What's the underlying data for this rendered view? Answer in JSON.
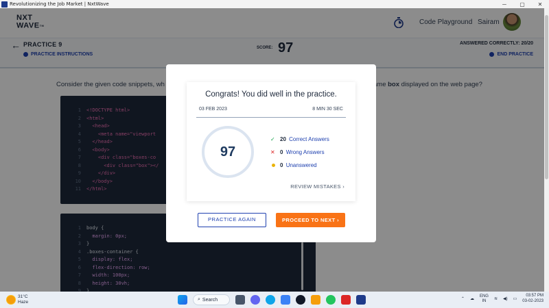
{
  "window": {
    "title": "Revolutionizing the Job Market | NxtWave",
    "minimize": "─",
    "maximize": "▢",
    "close": "✕"
  },
  "header": {
    "logo_line1": "NXT",
    "logo_line2": "WAVE",
    "logo_tm": "TM",
    "code_playground": "Code Playground",
    "username": "Sairam"
  },
  "practice_bar": {
    "title": "PRACTICE 9",
    "instructions": "PRACTICE INSTRUCTIONS",
    "score_label": "SCORE:",
    "score_value": "97",
    "answered": "ANSWERED CORRECTLY: 20/20",
    "end_practice": "END PRACTICE"
  },
  "question": {
    "left": "Consider the given code snippets, wh",
    "right_pre": "ame ",
    "right_bold": "box",
    "right_post": " displayed on the web page?"
  },
  "code_html": [
    {
      "n": "1",
      "t": "<!DOCTYPE html>"
    },
    {
      "n": "2",
      "t": "<html>"
    },
    {
      "n": "3",
      "t": "  <head>"
    },
    {
      "n": "4",
      "t": "    <meta name=\"viewport"
    },
    {
      "n": "5",
      "t": "  </head>"
    },
    {
      "n": "6",
      "t": "  <body>"
    },
    {
      "n": "7",
      "t": "    <div class=\"boxes-co"
    },
    {
      "n": "8",
      "t": "      <div class=\"box\"></"
    },
    {
      "n": "9",
      "t": "    </div>"
    },
    {
      "n": "10",
      "t": "  </body>"
    },
    {
      "n": "11",
      "t": "</html>"
    }
  ],
  "code_css": [
    {
      "n": "1",
      "t": "body {"
    },
    {
      "n": "2",
      "t": "  margin: 0px;"
    },
    {
      "n": "3",
      "t": "}"
    },
    {
      "n": "4",
      "t": ".boxes-container {"
    },
    {
      "n": "5",
      "t": "  display: flex;"
    },
    {
      "n": "6",
      "t": "  flex-direction: row;"
    },
    {
      "n": "7",
      "t": "  width: 100px;"
    },
    {
      "n": "8",
      "t": "  height: 30vh;"
    },
    {
      "n": "9",
      "t": "}"
    }
  ],
  "modal": {
    "congrats": "Congrats! You did well in the practice.",
    "date": "03 FEB 2023",
    "duration": "8 MIN 30 SEC",
    "score": "97",
    "correct_count": "20",
    "correct_label": "Correct Answers",
    "wrong_count": "0",
    "wrong_label": "Wrong Answers",
    "unanswered_count": "0",
    "unanswered_label": "Unanswered",
    "review": "REVIEW MISTAKES",
    "practice_again": "PRACTICE AGAIN",
    "proceed": "PROCEED TO NEXT"
  },
  "taskbar": {
    "temp": "31°C",
    "weather": "Haze",
    "search": "Search",
    "lang1": "ENG",
    "lang2": "IN",
    "time": "03:57 PM",
    "date": "03-02-2023"
  },
  "colors": {
    "accent": "#1e40af",
    "orange": "#f97316",
    "code_bg": "#1e293b"
  }
}
